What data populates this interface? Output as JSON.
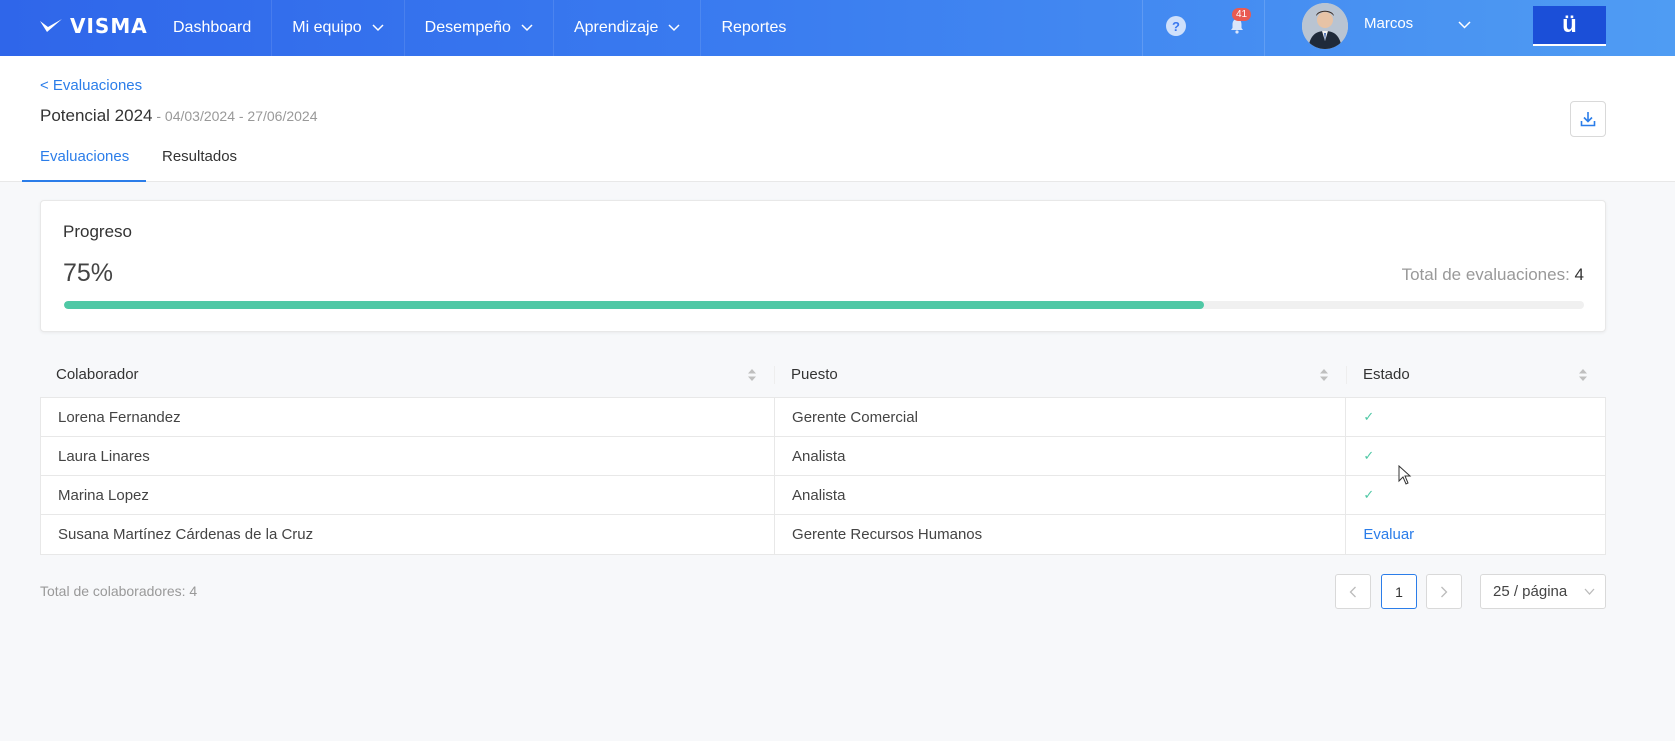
{
  "app": {
    "logo_text": "VISMA",
    "nav": [
      {
        "label": "Dashboard",
        "has_dropdown": false
      },
      {
        "label": "Mi equipo",
        "has_dropdown": true
      },
      {
        "label": "Desempeño",
        "has_dropdown": true
      },
      {
        "label": "Aprendizaje",
        "has_dropdown": true
      },
      {
        "label": "Reportes",
        "has_dropdown": false
      }
    ],
    "help_icon": "?",
    "notifications_count": "41",
    "user_name": "Marcos",
    "app_switch_label": "ü"
  },
  "header": {
    "back_link": "< Evaluaciones",
    "title": "Potencial 2024",
    "date_range": " - 04/03/2024 - 27/06/2024",
    "tabs": [
      {
        "label": "Evaluaciones",
        "active": true
      },
      {
        "label": "Resultados",
        "active": false
      }
    ]
  },
  "progress": {
    "title": "Progreso",
    "percent_label": "75%",
    "fraction": 0.75,
    "total_label": "Total de evaluaciones: ",
    "total_value": "4"
  },
  "table": {
    "columns": [
      "Colaborador",
      "Puesto",
      "Estado"
    ],
    "rows": [
      {
        "colaborador": "Lorena Fernandez",
        "puesto": "Gerente Comercial",
        "estado": "✓"
      },
      {
        "colaborador": "Laura Linares",
        "puesto": "Analista",
        "estado": "✓"
      },
      {
        "colaborador": "Marina Lopez",
        "puesto": "Analista",
        "estado": "✓"
      },
      {
        "colaborador": "Susana Martínez Cárdenas de la Cruz",
        "puesto": "Gerente Recursos Humanos",
        "estado": "Evaluar"
      }
    ]
  },
  "footer": {
    "total_colaboradores": "Total de colaboradores: 4",
    "current_page": "1",
    "page_size": "25 / página"
  },
  "colors": {
    "topbar_start": "#2f66ea",
    "topbar_end": "#4f9cf3",
    "accent": "#2b7de9",
    "progress_fill": "#4fc8a5",
    "badge": "#e95b52"
  }
}
